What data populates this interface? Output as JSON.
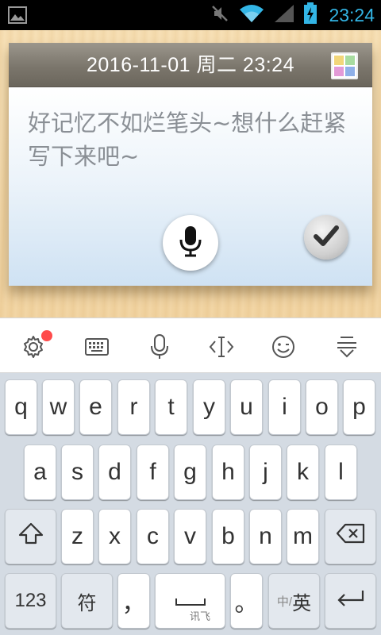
{
  "status_bar": {
    "time": "23:24",
    "icons": [
      "image-icon",
      "mute-icon",
      "wifi-icon",
      "signal-icon",
      "battery-charging-icon"
    ],
    "accent_color": "#33b5e5"
  },
  "note": {
    "date": "2016-11-01 周二 23:24",
    "hint": "好记忆不如烂笔头~想什么赶紧写下来吧~",
    "palette_colors": [
      "#f2d67a",
      "#a8dca0",
      "#e39ad7",
      "#8fb0e8"
    ],
    "icons": [
      "palette-icon",
      "mic-icon",
      "check-icon"
    ]
  },
  "keyboard_toolbar": {
    "icons": [
      "settings-icon",
      "keyboard-icon",
      "voice-icon",
      "cursor-icon",
      "emoji-icon",
      "hide-keyboard-icon"
    ]
  },
  "keyboard": {
    "row1": [
      "q",
      "w",
      "e",
      "r",
      "t",
      "y",
      "u",
      "i",
      "o",
      "p"
    ],
    "row2": [
      "a",
      "s",
      "d",
      "f",
      "g",
      "h",
      "j",
      "k",
      "l"
    ],
    "row3": [
      "z",
      "x",
      "c",
      "v",
      "b",
      "n",
      "m"
    ],
    "num_label": "123",
    "symbol_label": "符",
    "comma_label": "，",
    "space_brand": "讯飞",
    "period_label": "。",
    "lang_small": "中/",
    "lang_big": "英"
  }
}
